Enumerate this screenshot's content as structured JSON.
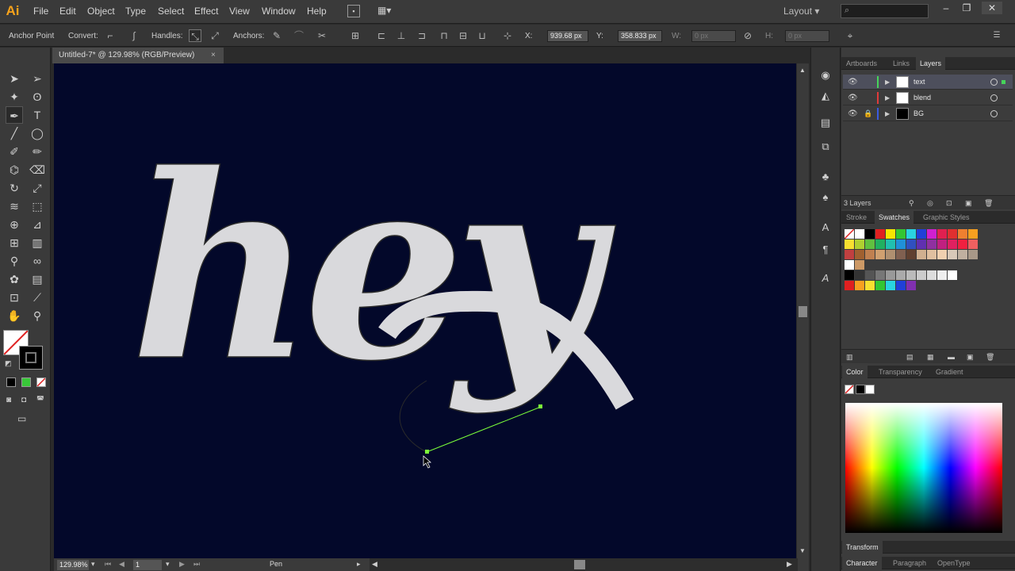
{
  "app": {
    "logo": "Ai"
  },
  "menu": [
    "File",
    "Edit",
    "Object",
    "Type",
    "Select",
    "Effect",
    "View",
    "Window",
    "Help"
  ],
  "workspace": "Layout",
  "control": {
    "tool_name": "Anchor Point",
    "convert_label": "Convert:",
    "handles_label": "Handles:",
    "anchors_label": "Anchors:",
    "x_label": "X:",
    "x_value": "939.68 px",
    "y_label": "Y:",
    "y_value": "358.833 px",
    "w_label": "W:",
    "w_value": "0 px",
    "h_label": "H:",
    "h_value": "0 px"
  },
  "document": {
    "tab_title": "Untitled-7* @ 129.98% (RGB/Preview)",
    "artwork_text": "hey"
  },
  "status": {
    "zoom": "129.98%",
    "artboard": "1",
    "tool": "Pen"
  },
  "layers_panel": {
    "tabs": [
      "Artboards",
      "Links",
      "Layers"
    ],
    "active_tab": "Layers",
    "layers": [
      {
        "name": "text",
        "color": "#46d35a",
        "selected": true
      },
      {
        "name": "blend",
        "color": "#e03a3a",
        "selected": false
      },
      {
        "name": "BG",
        "color": "#3a5be0",
        "selected": false
      }
    ],
    "count": "3 Layers"
  },
  "swatches_panel": {
    "tabs": [
      "Stroke",
      "Swatches",
      "Graphic Styles"
    ],
    "active_tab": "Swatches"
  },
  "color_panel": {
    "tabs": [
      "Color",
      "Transparency",
      "Gradient"
    ],
    "active_tab": "Color"
  },
  "collapsed_panels": [
    "Transform"
  ],
  "bottom_tabs": [
    "Character",
    "Paragraph",
    "OpenType"
  ],
  "colors": {
    "canvas": "#03082a",
    "letter_fill": "#d9d9dc",
    "path_stroke": "#2a2a2a",
    "selection": "#7cff3a",
    "accent": "#f7a21b"
  }
}
